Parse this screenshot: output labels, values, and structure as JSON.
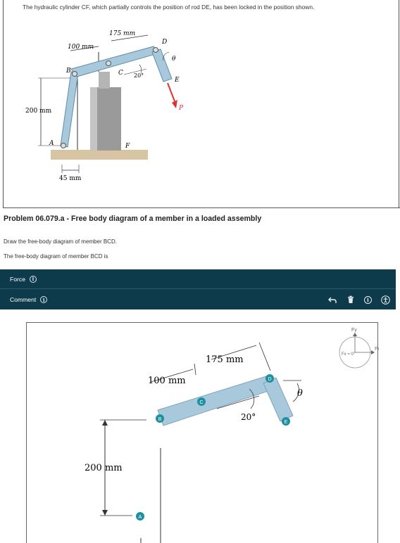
{
  "intro_text": "The hydraulic cylinder CF, which partially controls the position of rod DE, has been locked in the position shown.",
  "figure": {
    "dim_175": "175 mm",
    "dim_100": "100 mm",
    "dim_200": "200 mm",
    "dim_45": "45 mm",
    "angle_20": "20°",
    "label_A": "A",
    "label_B": "B",
    "label_C": "C",
    "label_D": "D",
    "label_E": "E",
    "label_F": "F",
    "label_P": "P",
    "label_theta": "θ"
  },
  "problem_title": "Problem 06.079.a - Free body diagram of a member in a loaded assembly",
  "instruction_1": "Draw the free-body diagram of member BCD.",
  "instruction_2": "The free-body diagram of member BCD is",
  "toolbar": {
    "force_label": "Force",
    "comment_label": "Comment",
    "info_glyph": "i"
  },
  "fbd": {
    "dim_175": "175 mm",
    "dim_100": "100 mm",
    "dim_200": "200 mm",
    "angle_20": "20°",
    "label_A": "A",
    "label_B": "B",
    "label_C": "C",
    "label_D": "D",
    "label_E": "E",
    "label_theta": "θ",
    "legend_fy": "Fy",
    "legend_fx": "Fx",
    "legend_fx_angle": "Fx = 0°"
  },
  "colors": {
    "toolbar_bg": "#0d3b4b",
    "member_fill": "#a8c8dc",
    "pin_fill": "#1f8fa0",
    "force_arrow": "#e03030"
  }
}
